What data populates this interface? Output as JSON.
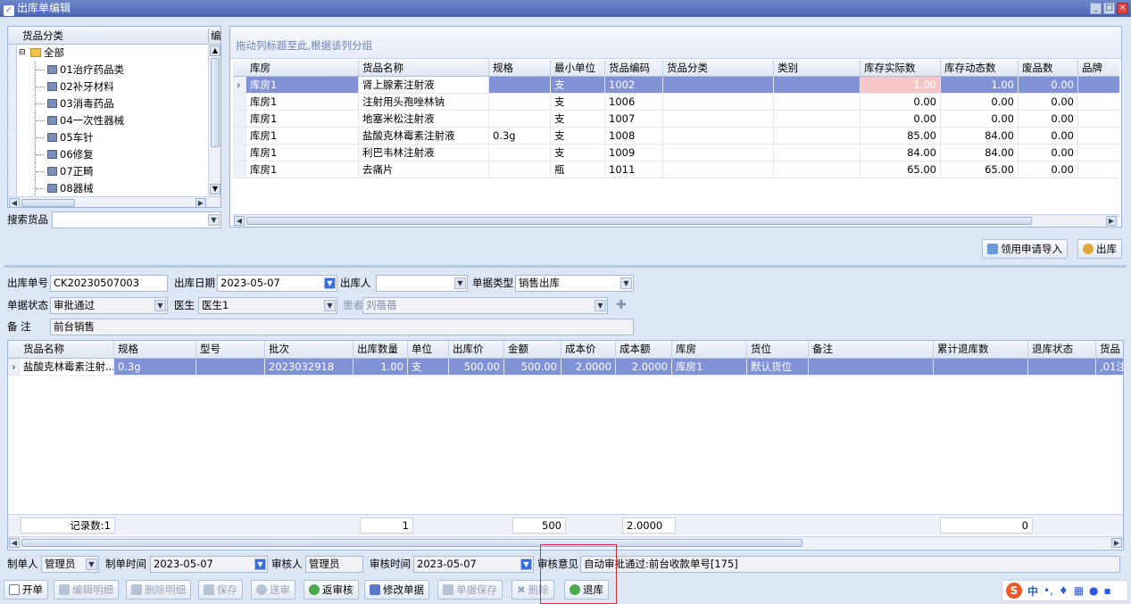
{
  "window": {
    "title": "出库单编辑"
  },
  "tree": {
    "header": "货品分类",
    "header2": "编",
    "root": "全部",
    "items": [
      "01治疗药品类",
      "02补牙材料",
      "03消毒药品",
      "04一次性器械",
      "05车针",
      "06修复",
      "07正畸",
      "08器械"
    ]
  },
  "search": {
    "label": "搜索货品"
  },
  "stock": {
    "group_hint": "拖动列标题至此,根据该列分组",
    "columns": [
      "库房",
      "货品名称",
      "规格",
      "最小单位",
      "货品编码",
      "货品分类",
      "类别",
      "库存实际数",
      "库存动态数",
      "废品数",
      "品牌"
    ],
    "rows": [
      [
        "库房1",
        "肾上腺素注射液",
        "",
        "支",
        "1002",
        "",
        "",
        "1.00",
        "1.00",
        "0.00",
        ""
      ],
      [
        "库房1",
        "注射用头孢唑林钠",
        "",
        "支",
        "1006",
        "",
        "",
        "0.00",
        "0.00",
        "0.00",
        ""
      ],
      [
        "库房1",
        "地塞米松注射液",
        "",
        "支",
        "1007",
        "",
        "",
        "0.00",
        "0.00",
        "0.00",
        ""
      ],
      [
        "库房1",
        "盐酸克林霉素注射液",
        "0.3g",
        "支",
        "1008",
        "",
        "",
        "85.00",
        "84.00",
        "0.00",
        ""
      ],
      [
        "库房1",
        "利巴韦林注射液",
        "",
        "支",
        "1009",
        "",
        "",
        "84.00",
        "84.00",
        "0.00",
        ""
      ],
      [
        "库房1",
        "去痛片",
        "",
        "瓶",
        "1011",
        "",
        "",
        "65.00",
        "65.00",
        "0.00",
        ""
      ]
    ]
  },
  "actions": {
    "import_label": "领用申请导入",
    "out_label": "出库"
  },
  "form": {
    "order_no_label": "出库单号",
    "order_no": "CK20230507003",
    "date_label": "出库日期",
    "date": "2023-05-07",
    "person_label": "出库人",
    "person": "",
    "type_label": "单据类型",
    "type": "销售出库",
    "status_label": "单据状态",
    "status": "审批通过",
    "doctor_label": "医生",
    "doctor": "医生1",
    "patient_label": "患者",
    "patient": "刘蓓蓓",
    "remark_label": "备  注",
    "remark": "前台销售"
  },
  "detail": {
    "columns": [
      "货品名称",
      "规格",
      "型号",
      "批次",
      "出库数量",
      "单位",
      "出库价",
      "金额",
      "成本价",
      "成本额",
      "库房",
      "货位",
      "备注",
      "累计退库数",
      "退库状态",
      "货品"
    ],
    "rows": [
      [
        "盐酸克林霉素注射...",
        "0.3g",
        "",
        "2023032918",
        "1.00",
        "支",
        "500.00",
        "500.00",
        "2.0000",
        "2.0000",
        "库房1",
        "默认货位",
        "",
        "",
        "",
        ",01注"
      ]
    ],
    "footer": {
      "count_label": "记录数:1",
      "qty": "1",
      "amount": "500",
      "cost": "2.0000",
      "returned": "0"
    }
  },
  "bottom": {
    "maker_label": "制单人",
    "maker": "管理员",
    "make_time_label": "制单时间",
    "make_time": "2023-05-07",
    "auditor_label": "审核人",
    "auditor": "管理员",
    "audit_time_label": "审核时间",
    "audit_time": "2023-05-07",
    "opinion_label": "审核意见",
    "opinion": "自动审批通过:前台收款单号[175]"
  },
  "toolbar": {
    "new": "开单",
    "edit_detail": "编辑明细",
    "del_detail": "删除明细",
    "save": "保存",
    "send": "送审",
    "unaudit": "返审核",
    "modify": "修改单据",
    "save_doc": "单据保存",
    "delete": "删除",
    "return": "退库"
  },
  "ime": {
    "lang": "中"
  },
  "colors": {
    "selected_row": "#8193d6",
    "highlight_cell": "#f6c6c6",
    "annotation": "#d83030"
  }
}
